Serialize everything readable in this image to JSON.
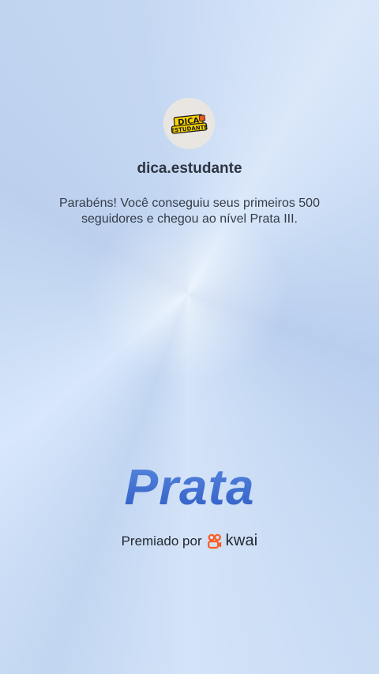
{
  "profile": {
    "username": "dica.estudante",
    "avatar_logo_text_top": "DICA",
    "avatar_logo_text_bottom": "ESTUDANTE"
  },
  "message": "Parabéns! Você conseguiu seus primeiros 500 seguidores e chegou ao nível Prata III.",
  "tier": {
    "title": "Prata"
  },
  "award": {
    "label": "Premiado por",
    "brand": "kwai",
    "brand_icon": "kwai-logo-icon"
  },
  "colors": {
    "tier_blue": "#3d6ed0",
    "kwai_orange": "#ff5a1f",
    "logo_yellow": "#f7d200"
  }
}
